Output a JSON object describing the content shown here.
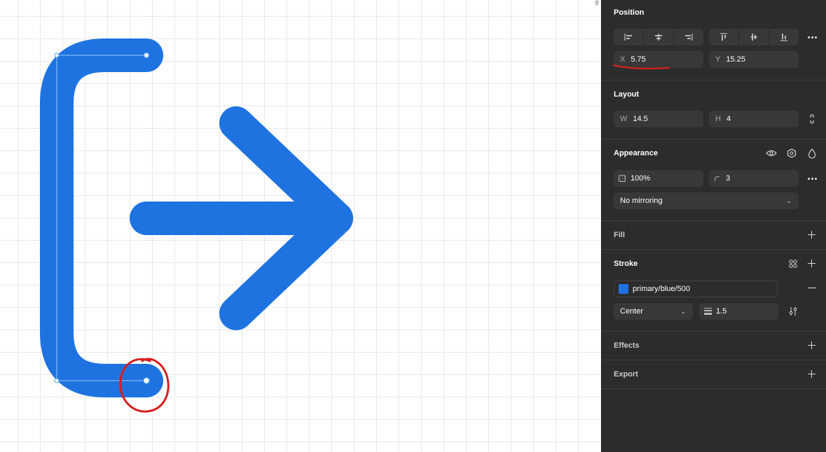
{
  "colors": {
    "shape_blue": "#1e73e1",
    "annotation_red": "#d81f1f",
    "selection_blue": "#46a6ff",
    "panel_bg": "#2c2c2c"
  },
  "position": {
    "title": "Position",
    "align_icons": [
      "align-left-icon",
      "align-horizontal-center-icon",
      "align-right-icon",
      "align-top-icon",
      "align-vertical-center-icon",
      "align-bottom-icon"
    ],
    "x_label": "X",
    "x_value": "5.75",
    "y_label": "Y",
    "y_value": "15.25"
  },
  "layout": {
    "title": "Layout",
    "w_label": "W",
    "w_value": "14.5",
    "h_label": "H",
    "h_value": "4"
  },
  "appearance": {
    "title": "Appearance",
    "opacity": "100%",
    "radius": "3",
    "mirroring": "No mirroring"
  },
  "fill": {
    "title": "Fill"
  },
  "stroke": {
    "title": "Stroke",
    "color_name": "primary/blue/500",
    "position": "Center",
    "weight": "1.5"
  },
  "effects": {
    "title": "Effects"
  },
  "export": {
    "title": "Export"
  }
}
